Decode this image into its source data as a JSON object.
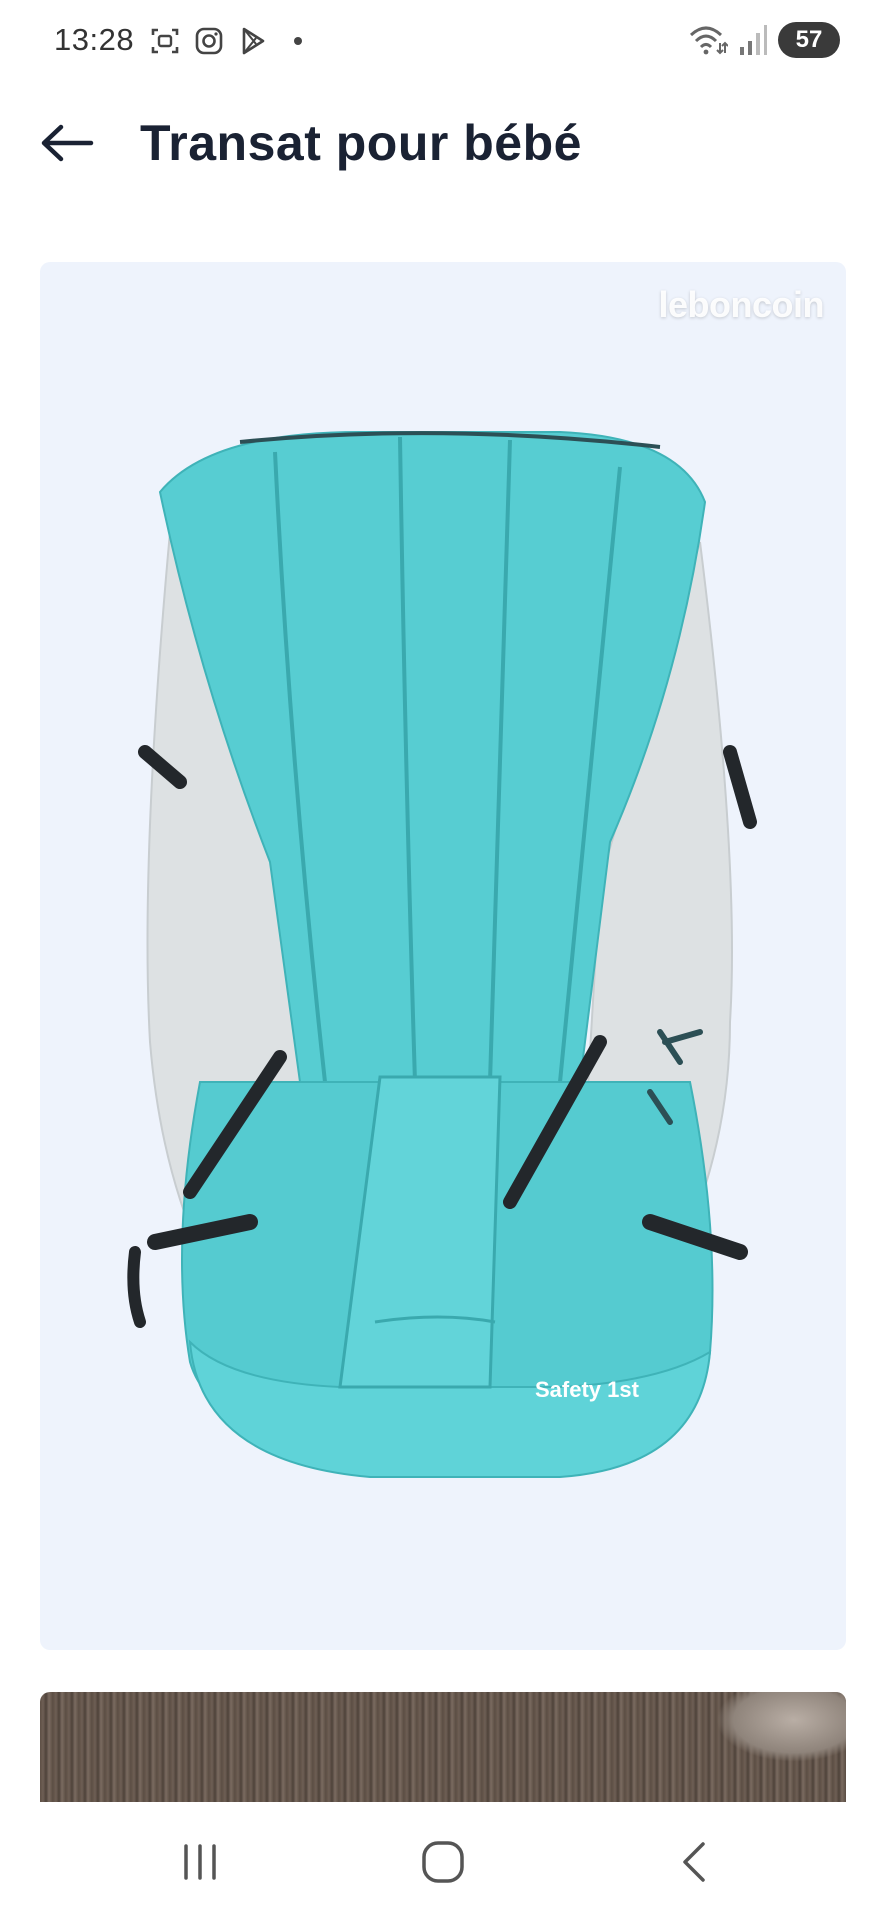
{
  "status_bar": {
    "time": "13:28",
    "battery_level": "57",
    "left_icons": [
      "screenshot-icon",
      "instagram-icon",
      "play-store-icon",
      "notification-dot"
    ],
    "right_icons": [
      "wifi-icon",
      "signal-icon",
      "battery-icon"
    ]
  },
  "header": {
    "back_icon": "arrow-left-icon",
    "title": "Transat pour bébé"
  },
  "gallery": {
    "watermark": "leboncoin",
    "main_photo": {
      "subject": "baby-bouncer-seat",
      "print_text": "Safety 1st"
    },
    "next_photo_partial": true
  },
  "nav_bar": {
    "buttons": [
      "recent-apps-icon",
      "home-icon",
      "back-chevron-icon"
    ]
  },
  "colors": {
    "title": "#1a2233",
    "photo_background": "#eef3fc",
    "seat_teal": "#57cdd2",
    "seat_grey": "#dde1e3",
    "strap": "#23272b"
  }
}
